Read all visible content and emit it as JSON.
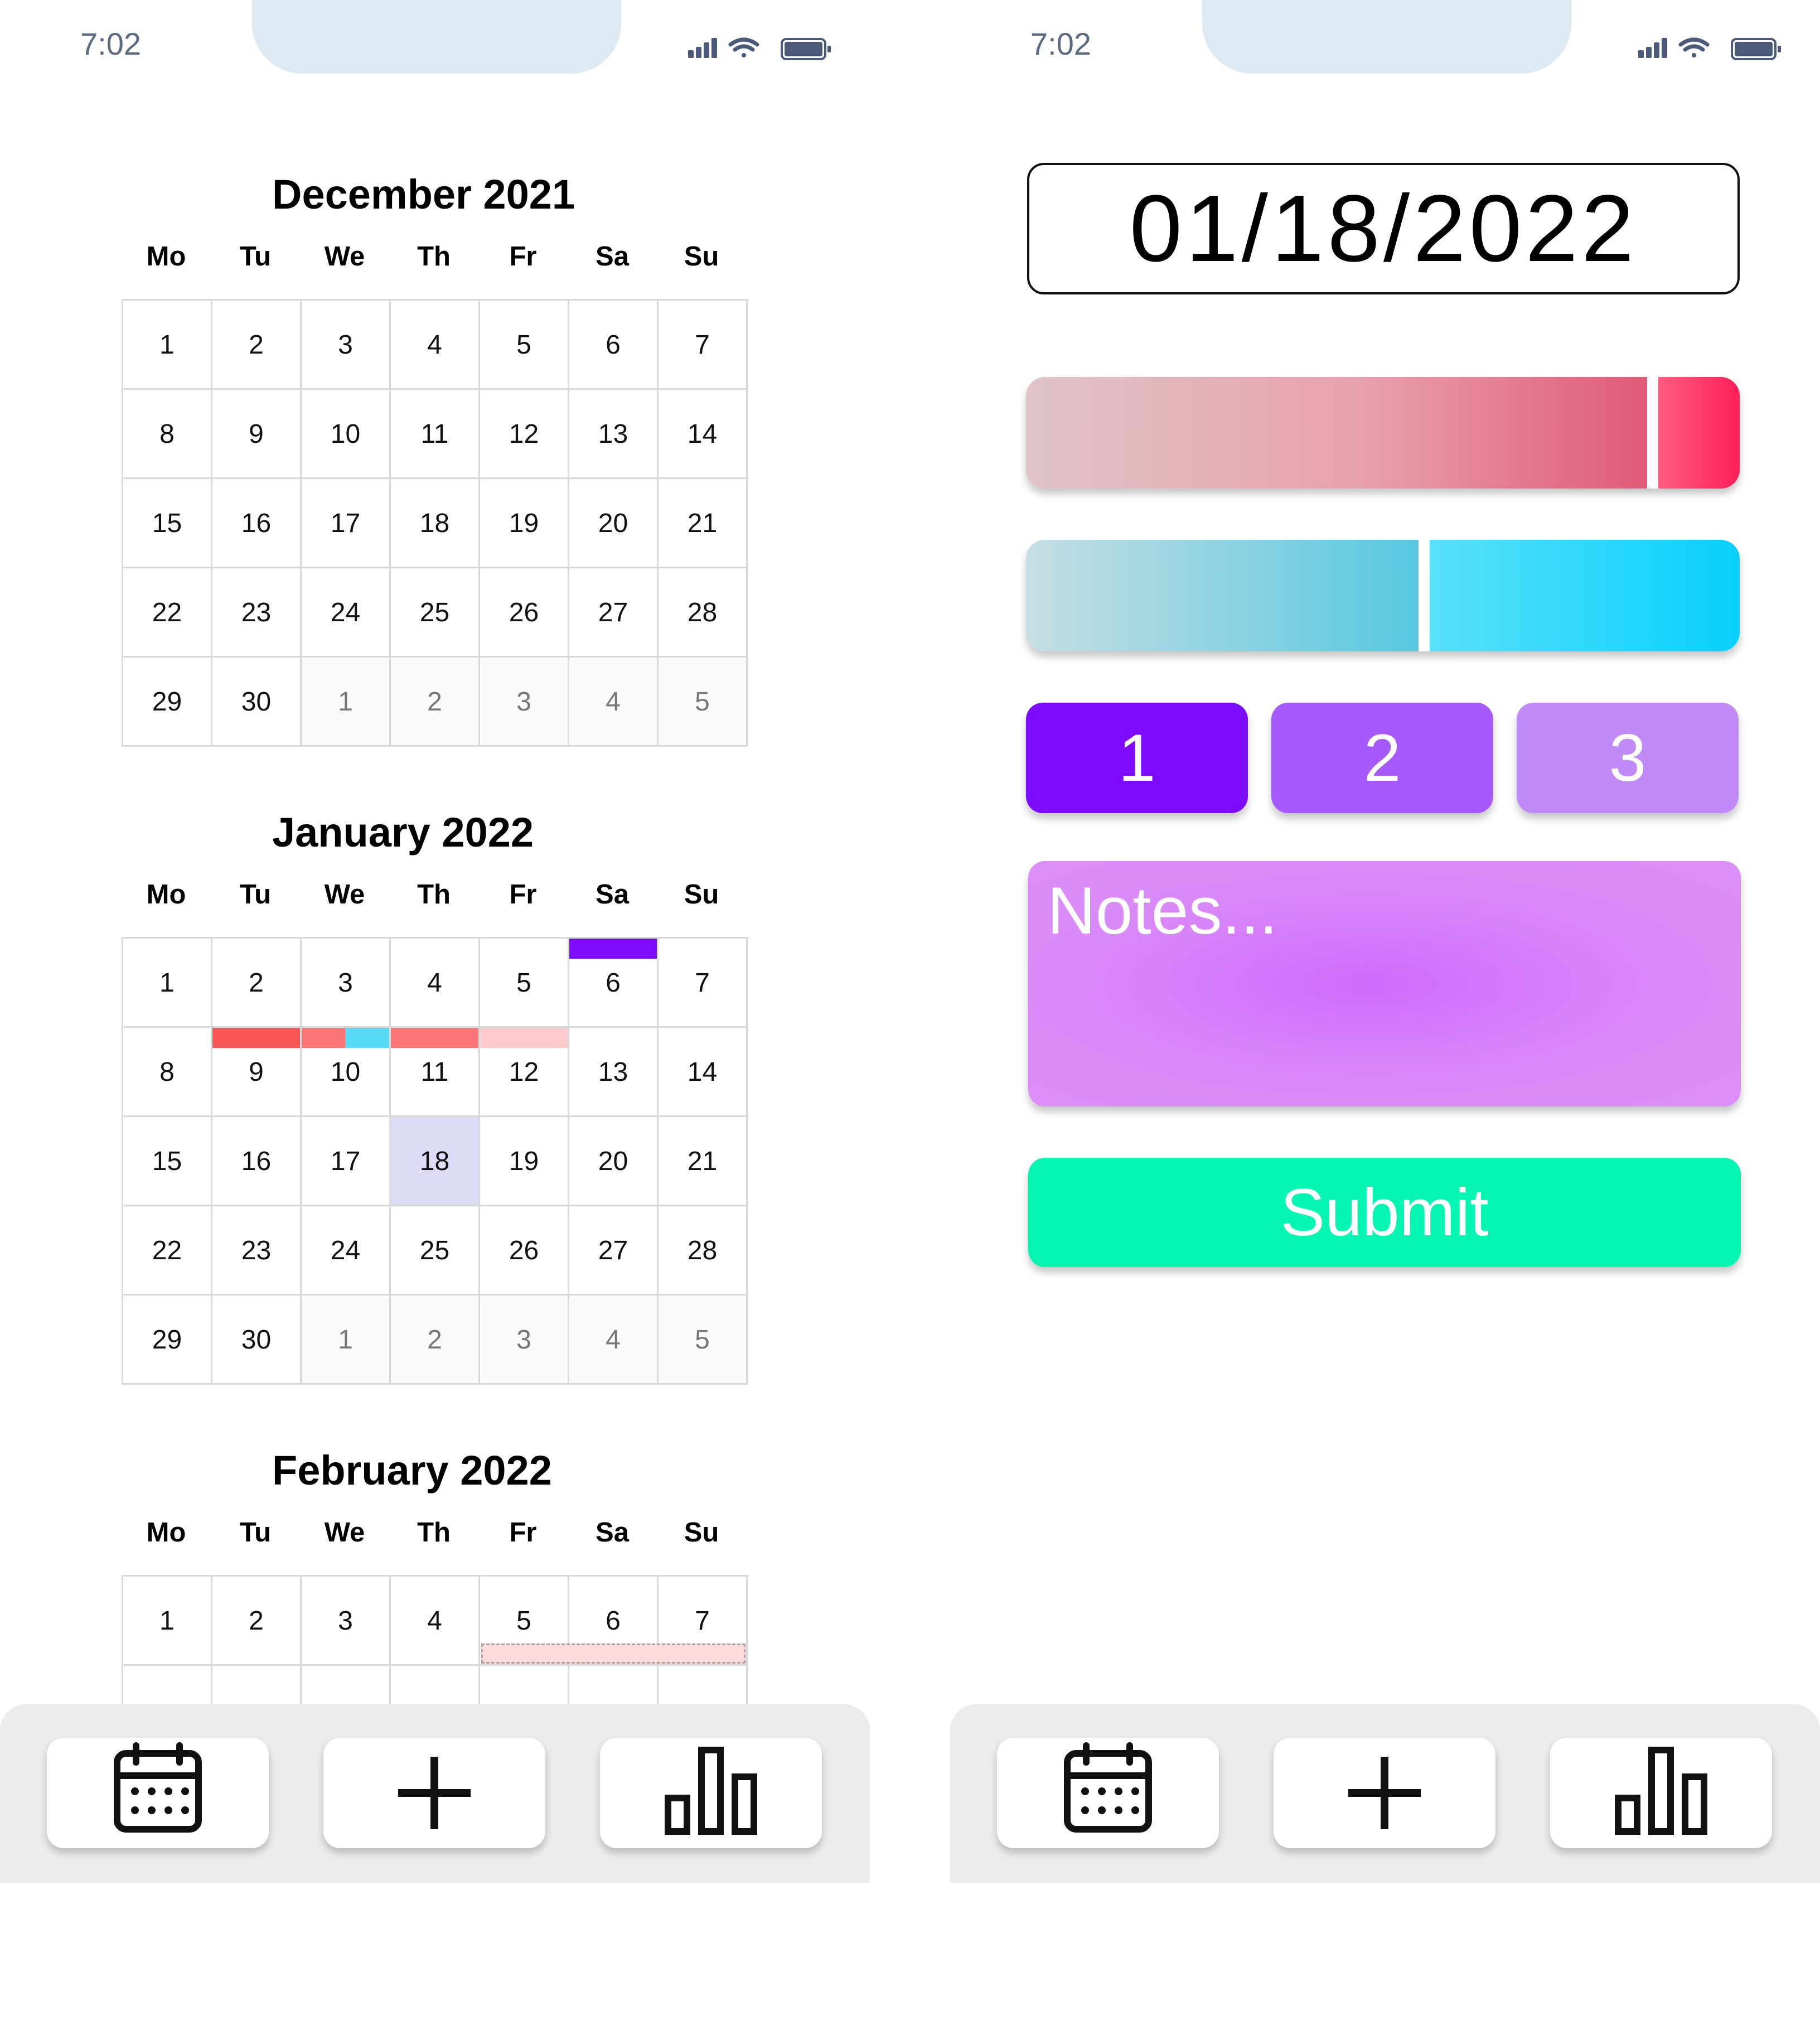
{
  "status_bar": {
    "time": "7:02"
  },
  "calendar": {
    "weekdays": [
      "Mo",
      "Tu",
      "We",
      "Th",
      "Fr",
      "Sa",
      "Su"
    ],
    "months": [
      {
        "title": "December 2021",
        "rows": [
          [
            "1",
            "2",
            "3",
            "4",
            "5",
            "6",
            "7"
          ],
          [
            "8",
            "9",
            "10",
            "11",
            "12",
            "13",
            "14"
          ],
          [
            "15",
            "16",
            "17",
            "18",
            "19",
            "20",
            "21"
          ],
          [
            "22",
            "23",
            "24",
            "25",
            "26",
            "27",
            "28"
          ],
          [
            "29",
            "30",
            "1",
            "2",
            "3",
            "4",
            "5"
          ]
        ],
        "outside_days_in_last_row": 5
      },
      {
        "title": "January 2022",
        "rows": [
          [
            "1",
            "2",
            "3",
            "4",
            "5",
            "6",
            "7"
          ],
          [
            "8",
            "9",
            "10",
            "11",
            "12",
            "13",
            "14"
          ],
          [
            "15",
            "16",
            "17",
            "18",
            "19",
            "20",
            "21"
          ],
          [
            "22",
            "23",
            "24",
            "25",
            "26",
            "27",
            "28"
          ],
          [
            "29",
            "30",
            "1",
            "2",
            "3",
            "4",
            "5"
          ]
        ],
        "outside_days_in_last_row": 5,
        "selected_day": "18",
        "entry_markers": [
          {
            "day": "6",
            "color": "#7d0cff"
          },
          {
            "day": "9",
            "color": "#fa5656"
          },
          {
            "day": "10",
            "color": "#fa7676"
          },
          {
            "day": "10",
            "color": "#58dcf6"
          },
          {
            "day": "11",
            "color": "#fa7676"
          },
          {
            "day": "12",
            "color": "#fccaca"
          }
        ]
      },
      {
        "title": "February 2022",
        "rows": [
          [
            "1",
            "2",
            "3",
            "4",
            "5",
            "6",
            "7"
          ],
          [
            "",
            "",
            "",
            "",
            "",
            "",
            ""
          ]
        ],
        "outside_days_in_last_row": 0,
        "pending_markers": [
          {
            "days": [
              "5",
              "6",
              "7"
            ],
            "color": "#fcdcdc",
            "style": "dashed"
          }
        ]
      }
    ]
  },
  "entry_form": {
    "date": "01/18/2022",
    "red_slider": {
      "value_percent": 87,
      "color": "#ff1f56"
    },
    "blue_slider": {
      "value_percent": 55,
      "color": "#07d0fb"
    },
    "level_buttons": [
      {
        "label": "1",
        "color": "#7d0cff",
        "selected": true
      },
      {
        "label": "2",
        "color": "#a65afc",
        "selected": false
      },
      {
        "label": "3",
        "color": "#c08af8",
        "selected": false
      }
    ],
    "notes_placeholder": "Notes...",
    "submit_label": "Submit",
    "submit_color": "#05f6b2"
  },
  "tab_bar": {
    "items": [
      {
        "icon": "calendar-icon"
      },
      {
        "icon": "plus-icon"
      },
      {
        "icon": "bar-chart-icon"
      }
    ]
  }
}
